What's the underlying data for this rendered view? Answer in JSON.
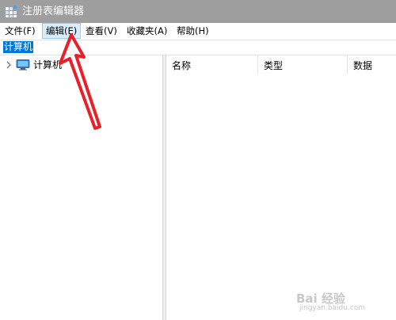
{
  "window": {
    "title": "注册表编辑器"
  },
  "menu": {
    "items": [
      {
        "label": "文件(F)"
      },
      {
        "label": "编辑(E)"
      },
      {
        "label": "查看(V)"
      },
      {
        "label": "收藏夹(A)"
      },
      {
        "label": "帮助(H)"
      }
    ],
    "selected_index": 1
  },
  "address": {
    "path": "计算机"
  },
  "tree": {
    "nodes": [
      {
        "label": "计算机",
        "icon": "computer-icon",
        "expanded": false
      }
    ]
  },
  "list": {
    "columns": [
      "名称",
      "类型",
      "数据"
    ]
  },
  "colors": {
    "titlebar": "#9e9e9e",
    "selection": "#0078d7",
    "annotation": "#e8202a"
  },
  "watermark": {
    "brand": "Bai 经验",
    "site": "jingyan.baidu.com"
  }
}
